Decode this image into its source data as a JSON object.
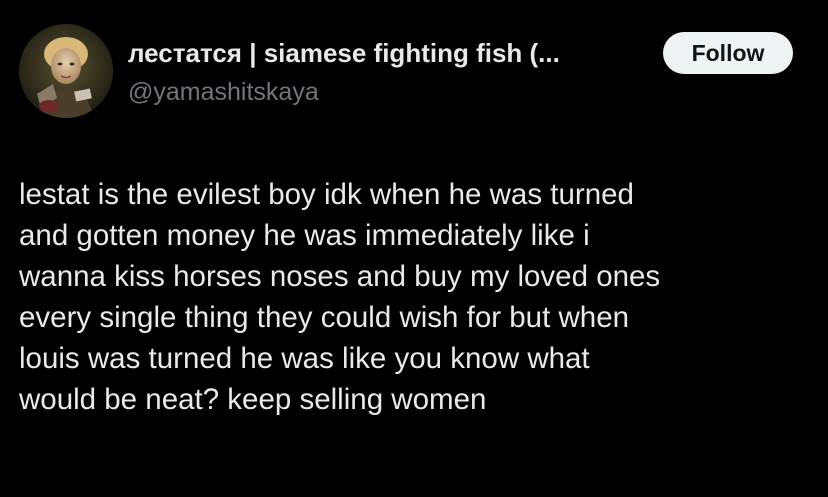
{
  "author": {
    "display_name": "лестатся | siamese fighting fish (...",
    "handle": "@yamashitskaya",
    "avatar_icon": "profile-photo"
  },
  "follow_button": {
    "label": "Follow"
  },
  "tweet": {
    "lines": [
      "lestat is the evilest boy idk when he was turned",
      "and gotten money he was immediately like i",
      "wanna kiss horses noses and buy my loved ones",
      "every single thing they could wish for but when",
      "louis was turned he was like you know what",
      "would be neat? keep selling women"
    ]
  },
  "colors": {
    "background": "#000000",
    "text_primary": "#e7e9ea",
    "text_secondary": "#71767b",
    "follow_bg": "#eff3f4",
    "follow_text": "#0f1419"
  }
}
